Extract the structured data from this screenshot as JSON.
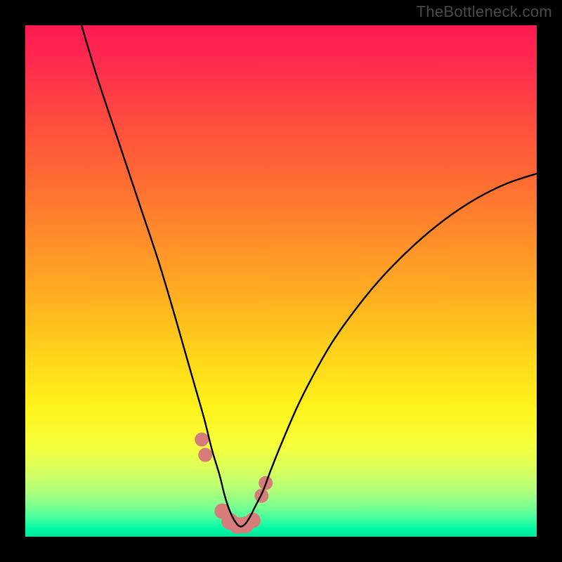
{
  "watermark": "TheBottleneck.com",
  "chart_data": {
    "type": "line",
    "title": "",
    "xlabel": "",
    "ylabel": "",
    "xlim": [
      0,
      100
    ],
    "ylim": [
      0,
      100
    ],
    "series": [
      {
        "name": "curve",
        "x": [
          11,
          14,
          18,
          22,
          26,
          29,
          31,
          33,
          35,
          36.5,
          38,
          39,
          40,
          41,
          42,
          43,
          44,
          45,
          46.5,
          48,
          50,
          53,
          56,
          60,
          65,
          70,
          76,
          82,
          88,
          94,
          100
        ],
        "values": [
          100,
          90,
          78,
          66,
          54,
          44,
          37,
          30,
          23,
          17,
          12,
          8,
          5,
          3,
          2,
          2.5,
          4,
          6,
          9,
          13,
          18,
          25,
          31,
          38,
          45,
          51,
          57,
          62,
          66,
          69,
          71
        ]
      }
    ],
    "markers": {
      "name": "tolerance-beads",
      "color": "#d77b7b",
      "x": [
        34.5,
        35.2,
        38.5,
        40.0,
        41.5,
        43.0,
        44.5,
        46.2,
        47.0
      ],
      "values": [
        19.0,
        16.0,
        5.0,
        3.0,
        2.2,
        2.3,
        3.2,
        8.0,
        10.5
      ],
      "r": [
        10,
        10,
        11,
        12,
        12,
        12,
        11,
        10,
        10
      ]
    },
    "gradient_stops": [
      {
        "offset": 0.0,
        "color": "#ff1a53"
      },
      {
        "offset": 0.07,
        "color": "#ff2a4f"
      },
      {
        "offset": 0.18,
        "color": "#ff4a3f"
      },
      {
        "offset": 0.3,
        "color": "#ff6b33"
      },
      {
        "offset": 0.42,
        "color": "#ff8e2a"
      },
      {
        "offset": 0.54,
        "color": "#ffb220"
      },
      {
        "offset": 0.66,
        "color": "#ffd91a"
      },
      {
        "offset": 0.75,
        "color": "#fff41c"
      },
      {
        "offset": 0.82,
        "color": "#f6ff3a"
      },
      {
        "offset": 0.87,
        "color": "#d9ff5e"
      },
      {
        "offset": 0.91,
        "color": "#afff7a"
      },
      {
        "offset": 0.94,
        "color": "#7dff8f"
      },
      {
        "offset": 0.965,
        "color": "#3fffa0"
      },
      {
        "offset": 0.985,
        "color": "#00f7a5"
      },
      {
        "offset": 1.0,
        "color": "#00e39c"
      }
    ]
  }
}
